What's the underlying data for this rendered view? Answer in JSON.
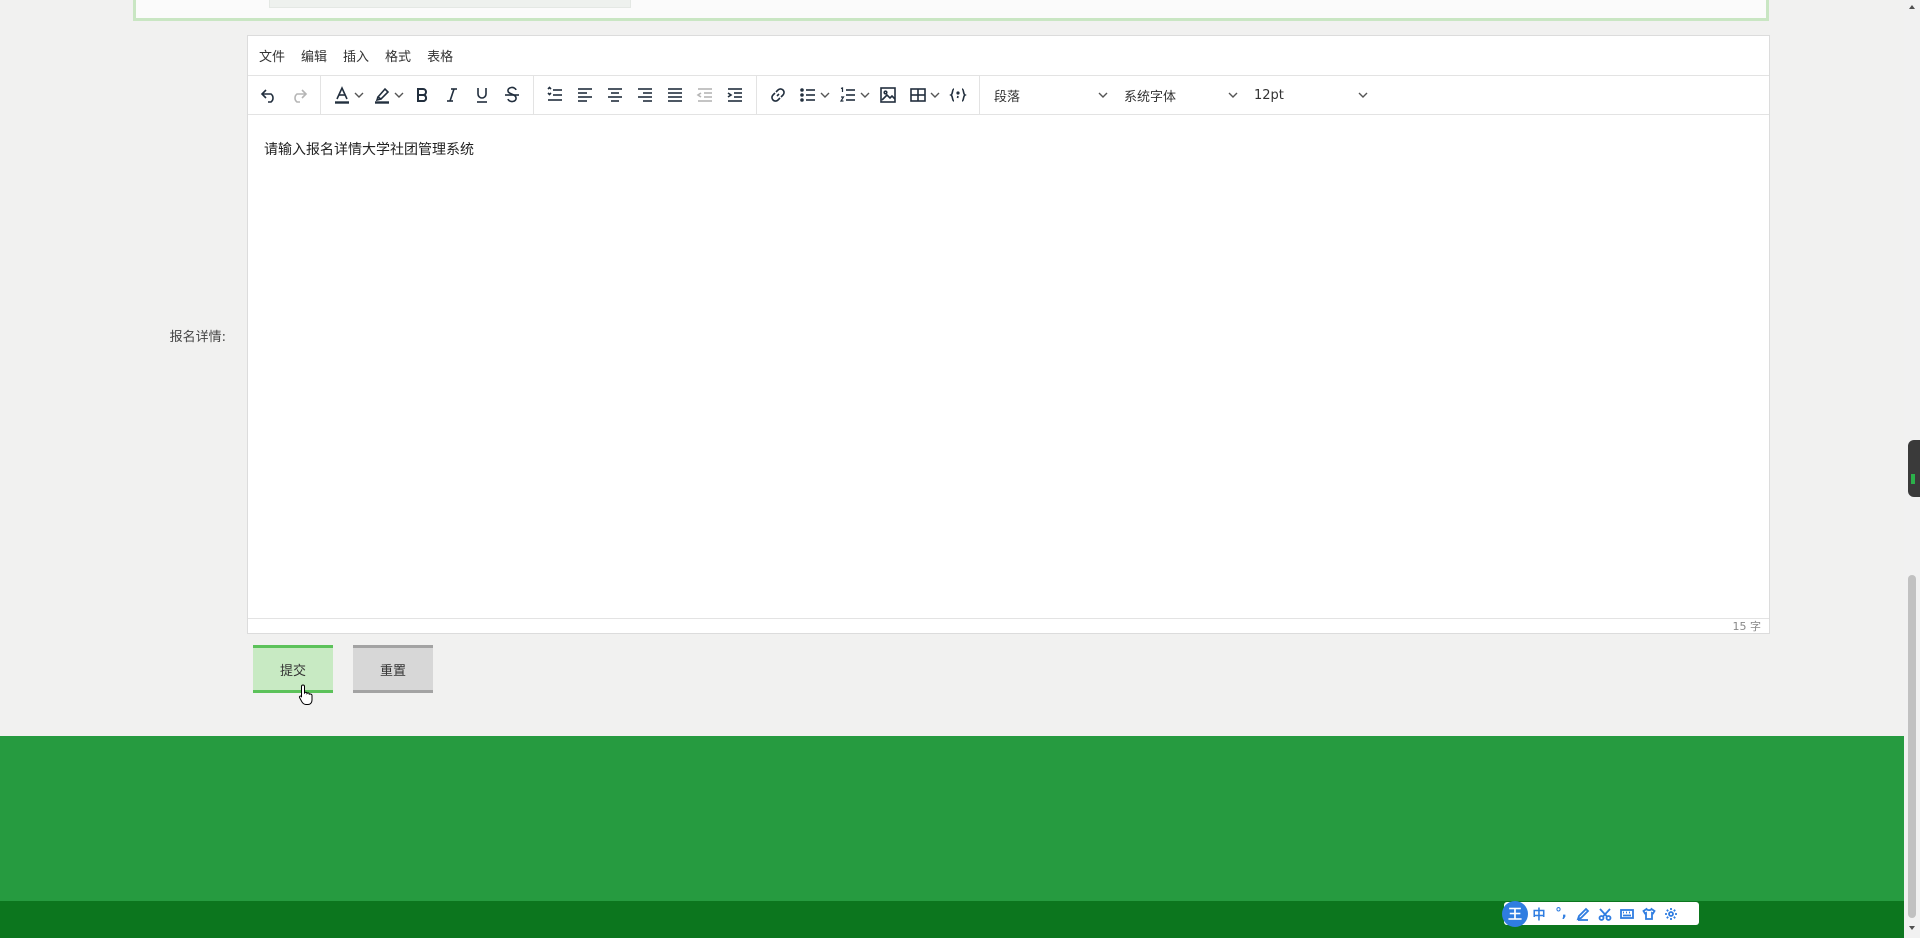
{
  "form": {
    "detail_label": "报名详情:",
    "submit_label": "提交",
    "reset_label": "重置"
  },
  "editor": {
    "menu": [
      "文件",
      "编辑",
      "插入",
      "格式",
      "表格"
    ],
    "block_format": "段落",
    "font_family": "系统字体",
    "font_size": "12pt",
    "content": "请输入报名详情大学社团管理系统",
    "word_count": "15 字",
    "toolbar_icons": [
      "undo-icon",
      "redo-icon",
      "text-color-icon",
      "highlight-color-icon",
      "bold-icon",
      "italic-icon",
      "underline-icon",
      "strikethrough-icon",
      "line-height-icon",
      "align-left-icon",
      "align-center-icon",
      "align-right-icon",
      "align-justify-icon",
      "outdent-icon",
      "indent-icon",
      "link-icon",
      "bullet-list-icon",
      "numbered-list-icon",
      "image-icon",
      "table-icon",
      "code-sample-icon"
    ]
  },
  "ime": {
    "logo": "王",
    "mode": "中",
    "punct": "°,"
  },
  "colors": {
    "footer": "#269b40",
    "footer_bottom": "#0c761e",
    "submit_bg": "#c8eac3",
    "submit_border": "#5cc25a",
    "reset_bg": "#d7d7d7",
    "ime_blue": "#2f7de1"
  }
}
